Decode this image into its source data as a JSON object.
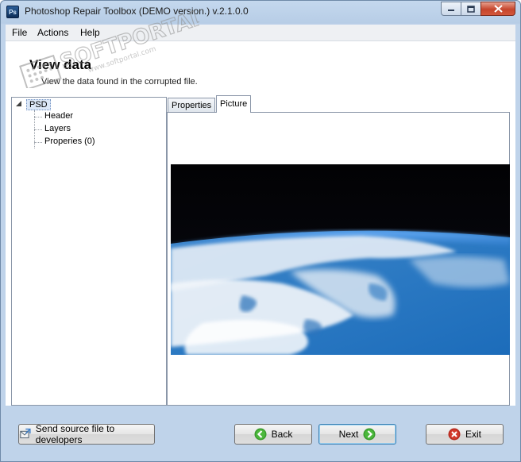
{
  "window": {
    "title": "Photoshop Repair Toolbox (DEMO version.) v.2.1.0.0",
    "app_icon_text": "Ps"
  },
  "menu": {
    "items": [
      "File",
      "Actions",
      "Help"
    ]
  },
  "page": {
    "title": "View data",
    "subtitle": "View the data found in the corrupted file."
  },
  "tree": {
    "root": "PSD",
    "children": [
      "Header",
      "Layers",
      "Properies (0)"
    ]
  },
  "tabs": {
    "items": [
      "Properties",
      "Picture"
    ],
    "active": "Picture"
  },
  "buttons": {
    "send": "Send source file to developers",
    "back": "Back",
    "next": "Next",
    "exit": "Exit"
  },
  "watermark": {
    "brand": "SOFTPORTAL",
    "url": "www.softportal.com"
  },
  "colors": {
    "frame": "#bfd3ea",
    "close_button": "#c6452c",
    "back_icon": "#3a9b2e",
    "exit_icon": "#d33a2c"
  }
}
